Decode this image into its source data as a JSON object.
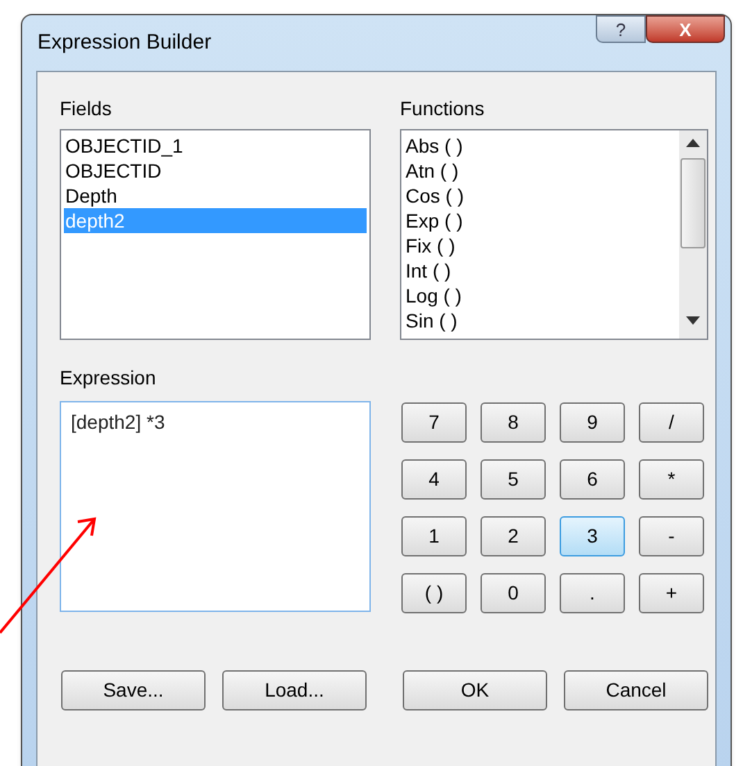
{
  "window": {
    "title": "Expression Builder",
    "buttons": [
      {
        "kind": "help",
        "label": "?"
      },
      {
        "kind": "close",
        "label": "X"
      }
    ]
  },
  "fields": {
    "label": "Fields",
    "items": [
      {
        "label": "OBJECTID_1",
        "selected": false
      },
      {
        "label": "OBJECTID",
        "selected": false
      },
      {
        "label": "Depth",
        "selected": false
      },
      {
        "label": "depth2",
        "selected": true
      }
    ]
  },
  "functions": {
    "label": "Functions",
    "items": [
      "Abs ( )",
      "Atn ( )",
      "Cos ( )",
      "Exp ( )",
      "Fix ( )",
      "Int ( )",
      "Log ( )",
      "Sin ( )"
    ]
  },
  "expression": {
    "label": "Expression",
    "value": "[depth2] *3"
  },
  "keypad": [
    {
      "label": "7",
      "selected": false
    },
    {
      "label": "8",
      "selected": false
    },
    {
      "label": "9",
      "selected": false
    },
    {
      "label": "/",
      "selected": false
    },
    {
      "label": "4",
      "selected": false
    },
    {
      "label": "5",
      "selected": false
    },
    {
      "label": "6",
      "selected": false
    },
    {
      "label": "*",
      "selected": false
    },
    {
      "label": "1",
      "selected": false
    },
    {
      "label": "2",
      "selected": false
    },
    {
      "label": "3",
      "selected": true
    },
    {
      "label": "-",
      "selected": false
    },
    {
      "label": "( )",
      "selected": false
    },
    {
      "label": "0",
      "selected": false
    },
    {
      "label": ".",
      "selected": false
    },
    {
      "label": "+",
      "selected": false
    }
  ],
  "buttons": [
    "Save...",
    "Load...",
    "OK",
    "Cancel"
  ]
}
